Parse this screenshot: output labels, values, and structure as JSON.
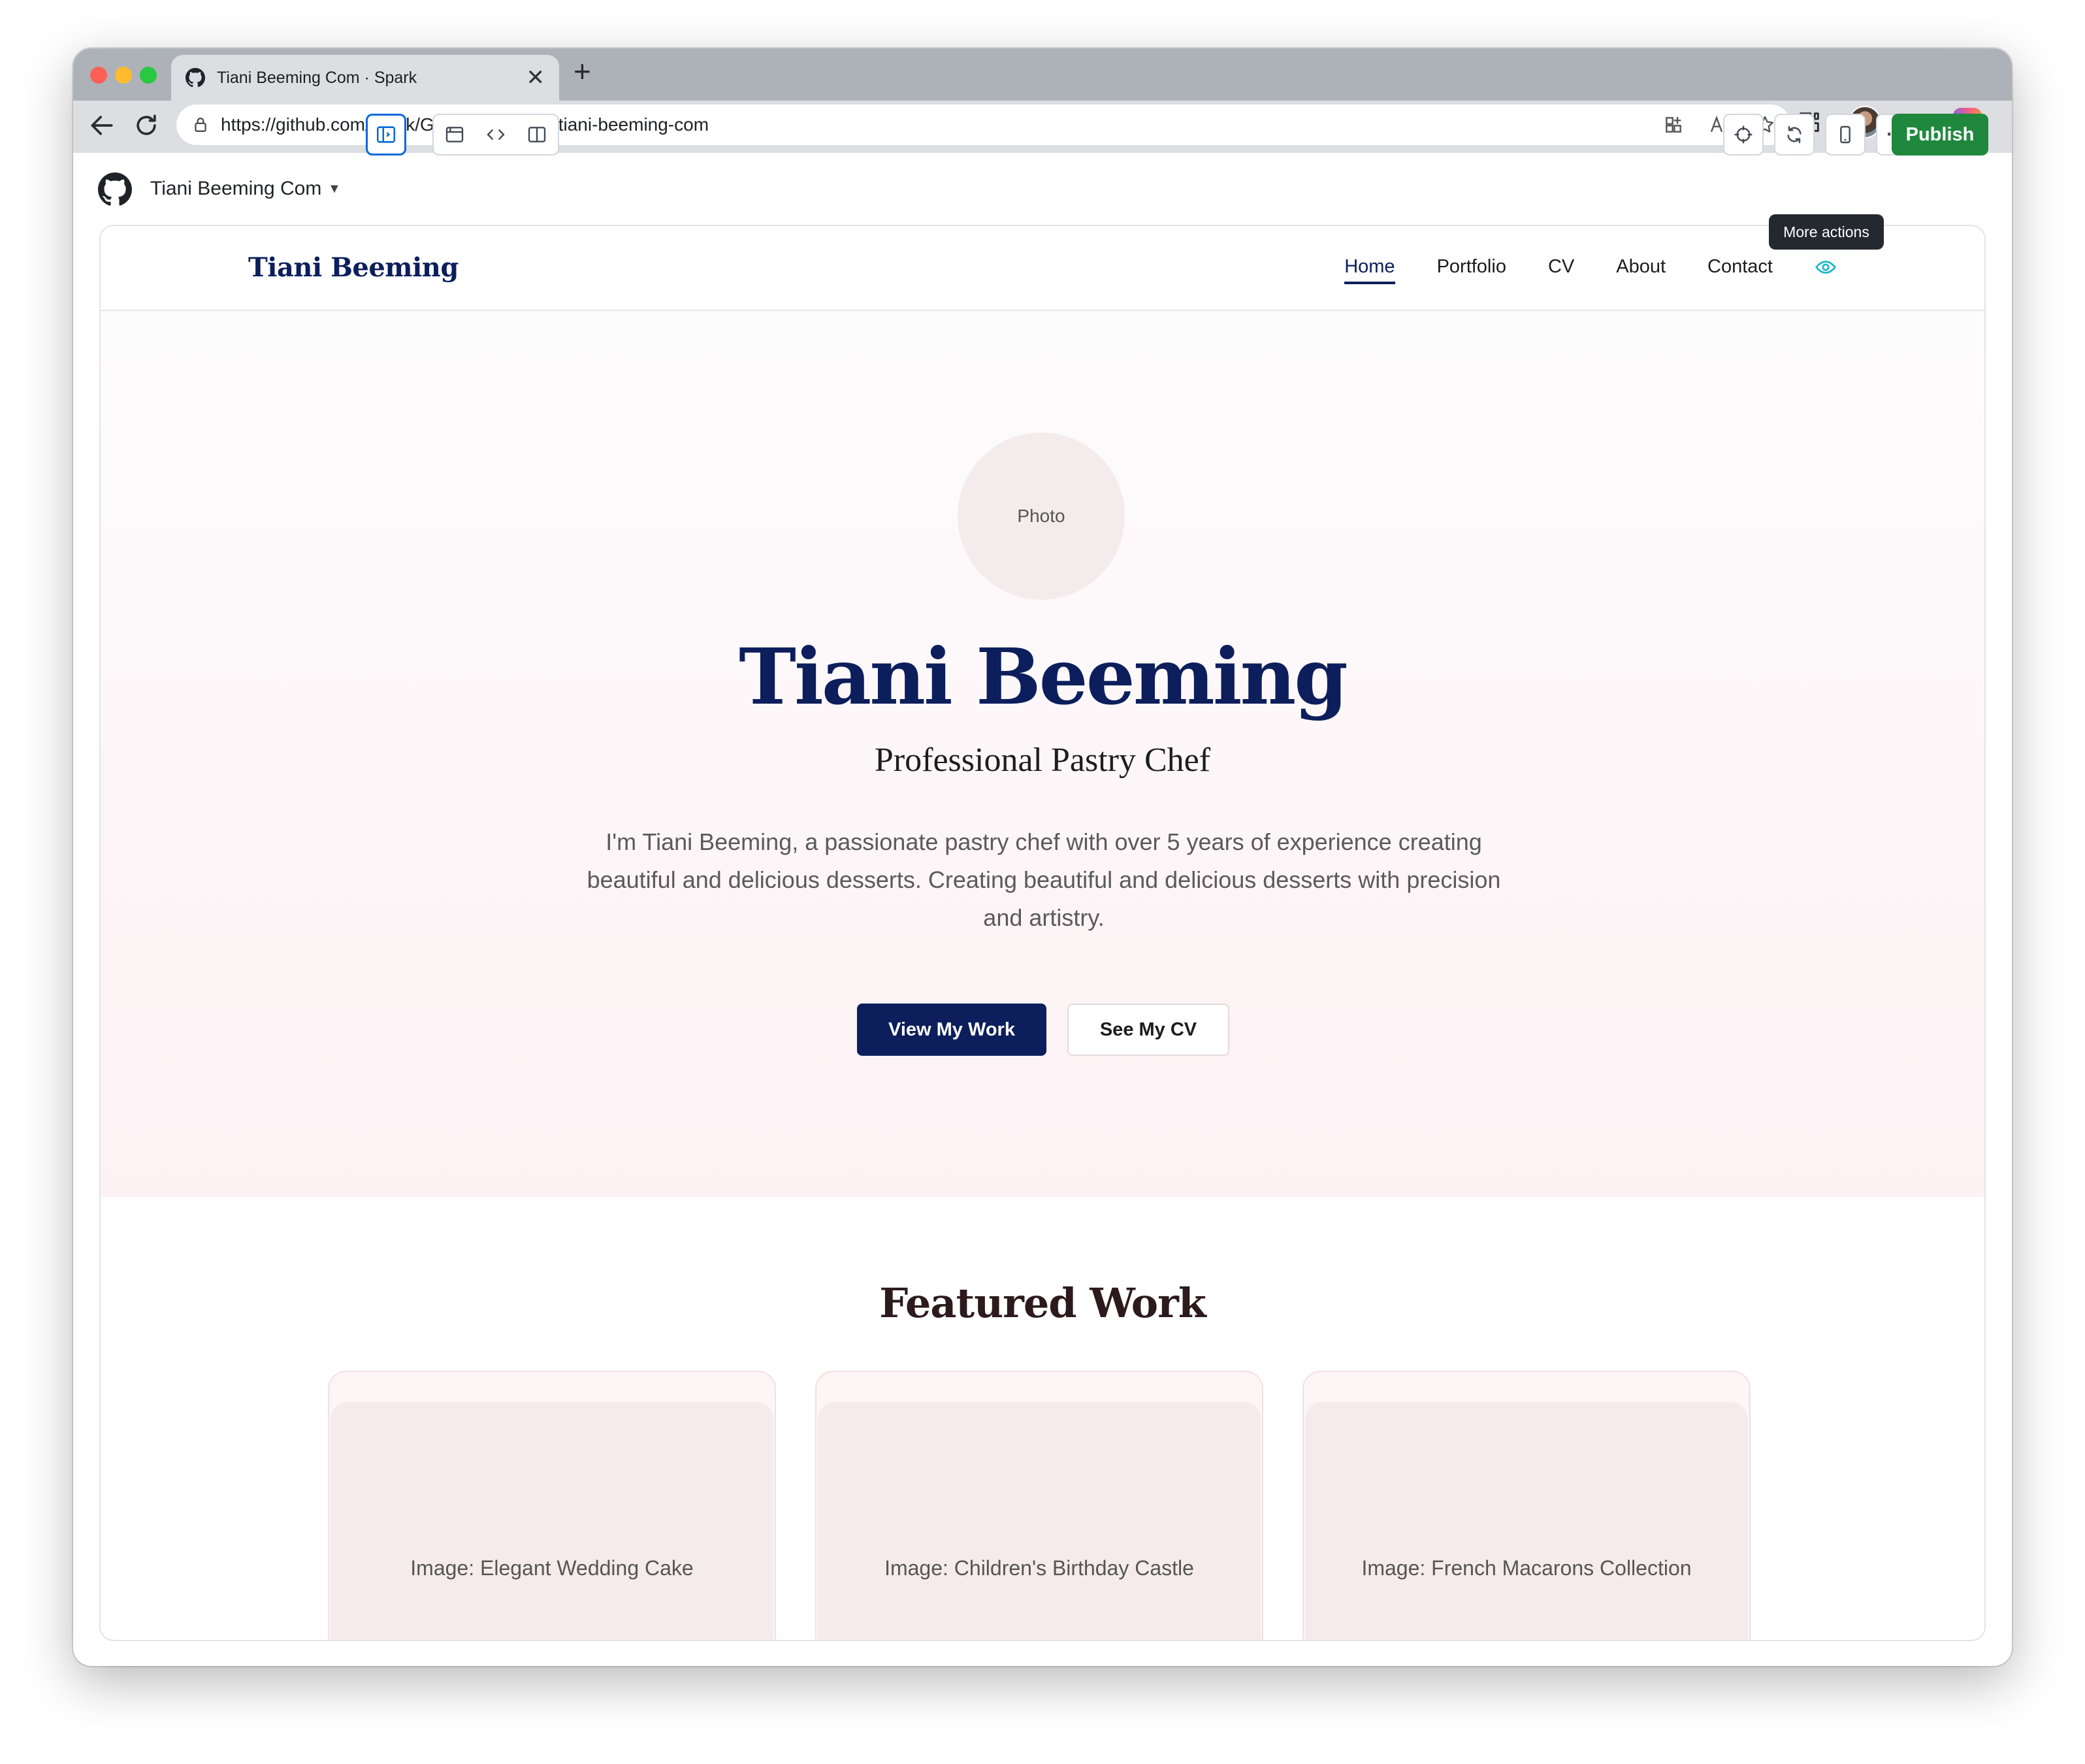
{
  "browser": {
    "tab_title": "Tiani Beeming Com · Spark",
    "tab_close": "✕",
    "new_tab": "+",
    "url": "https://github.com/spark/GordonBeeming/tiani-beeming-com",
    "menu_label": "···"
  },
  "spark": {
    "project_name": "Tiani Beeming Com",
    "publish_label": "Publish",
    "tooltip": "More actions",
    "more_label": "···"
  },
  "site": {
    "brand": "Tiani Beeming",
    "nav": {
      "home": "Home",
      "portfolio": "Portfolio",
      "cv": "CV",
      "about": "About",
      "contact": "Contact"
    },
    "hero": {
      "photo_label": "Photo",
      "name": "Tiani Beeming",
      "role": "Professional Pastry Chef",
      "bio": "I'm Tiani Beeming, a passionate pastry chef with over 5 years of experience creating beautiful and delicious desserts. Creating beautiful and delicious desserts with precision and artistry.",
      "primary_button": "View My Work",
      "secondary_button": "See My CV"
    },
    "featured": {
      "title": "Featured Work",
      "items": [
        {
          "image_label": "Image: Elegant Wedding Cake"
        },
        {
          "image_label": "Image: Children's Birthday Castle"
        },
        {
          "image_label": "Image: French Macarons Collection"
        }
      ]
    }
  },
  "colors": {
    "brand_navy": "#0c1e5b",
    "publish_green": "#1f883d",
    "active_blue": "#0969da",
    "eye_teal": "#21b8c7"
  }
}
